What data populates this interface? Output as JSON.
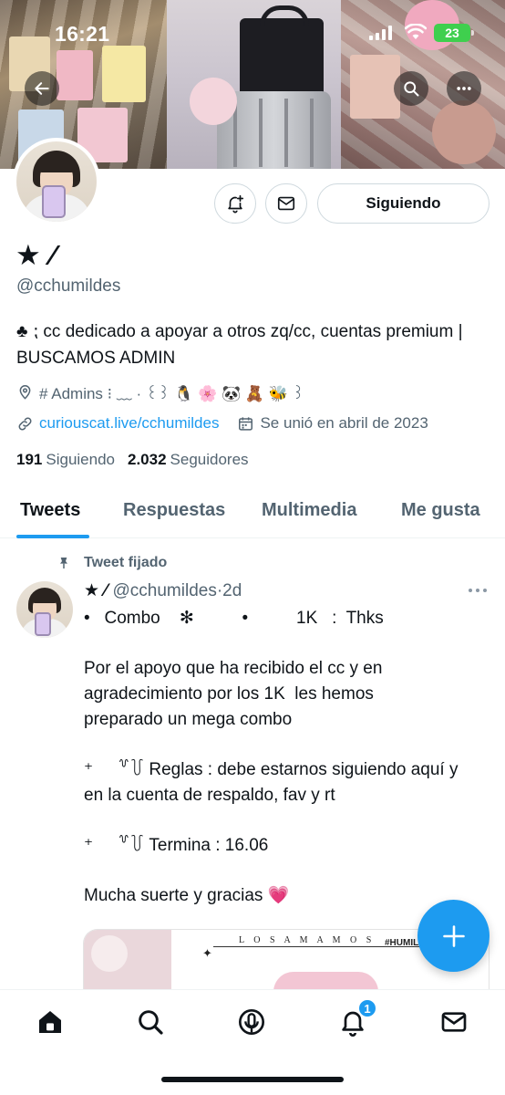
{
  "status_bar": {
    "time": "16:21",
    "battery": "23"
  },
  "profile": {
    "display_name": "★ ⁄",
    "handle": "@cchumildes",
    "bio": "♣︎ ⁏ cc dedicado a apoyar a otros zq/cc, cuentas premium | BUSCAMOS ADMIN",
    "location": "# Admins ⁝ ﹏ · ꒰꒱ 🐧 🌸 🐼 🧸 🐝 ꒱",
    "website": "curiouscat.live/cchumildes",
    "joined": "Se unió en abril de 2023",
    "following_count": "191",
    "following_label": "Siguiendo",
    "followers_count": "2.032",
    "followers_label": "Seguidores",
    "follow_button_label": "Siguiendo"
  },
  "tabs": [
    {
      "label": "Tweets",
      "active": true
    },
    {
      "label": "Respuestas",
      "active": false
    },
    {
      "label": "Multimedia",
      "active": false
    },
    {
      "label": "Me gusta",
      "active": false
    }
  ],
  "pinned_tweet": {
    "pinned_label": "Tweet fijado",
    "name": "★ ⁄",
    "handle": "@cchumildes",
    "separator": "·",
    "time": "2d",
    "lines": [
      "•   Combo    ✻          •          1K   :  Thks",
      "",
      "Por el apoyo que ha recibido el cc y en",
      "agradecimiento por los 1K  les hemos",
      "preparado un mega combo",
      "",
      "⁺     ꒷꒦ Reglas : debe estarnos siguiendo aquí y",
      "en la cuenta de respaldo, fav y rt",
      "",
      "⁺     ꒷꒦ Termina : 16.06",
      "",
      "Mucha suerte y gracias 💗"
    ],
    "media": {
      "title": "L O S  A M A M O S",
      "tag": "#HUMILD"
    }
  },
  "bottom_nav": {
    "notifications_badge": "1"
  },
  "colors": {
    "accent": "#1d9bf0",
    "text_primary": "#0f1419",
    "text_secondary": "#536471",
    "border": "#cfd9de"
  },
  "icons": [
    "back-arrow-icon",
    "search-icon",
    "more-icon",
    "bell-plus-icon",
    "mail-icon",
    "location-pin-icon",
    "link-icon",
    "calendar-icon",
    "pin-icon",
    "plus-icon",
    "home-icon",
    "spaces-icon",
    "bell-icon"
  ]
}
